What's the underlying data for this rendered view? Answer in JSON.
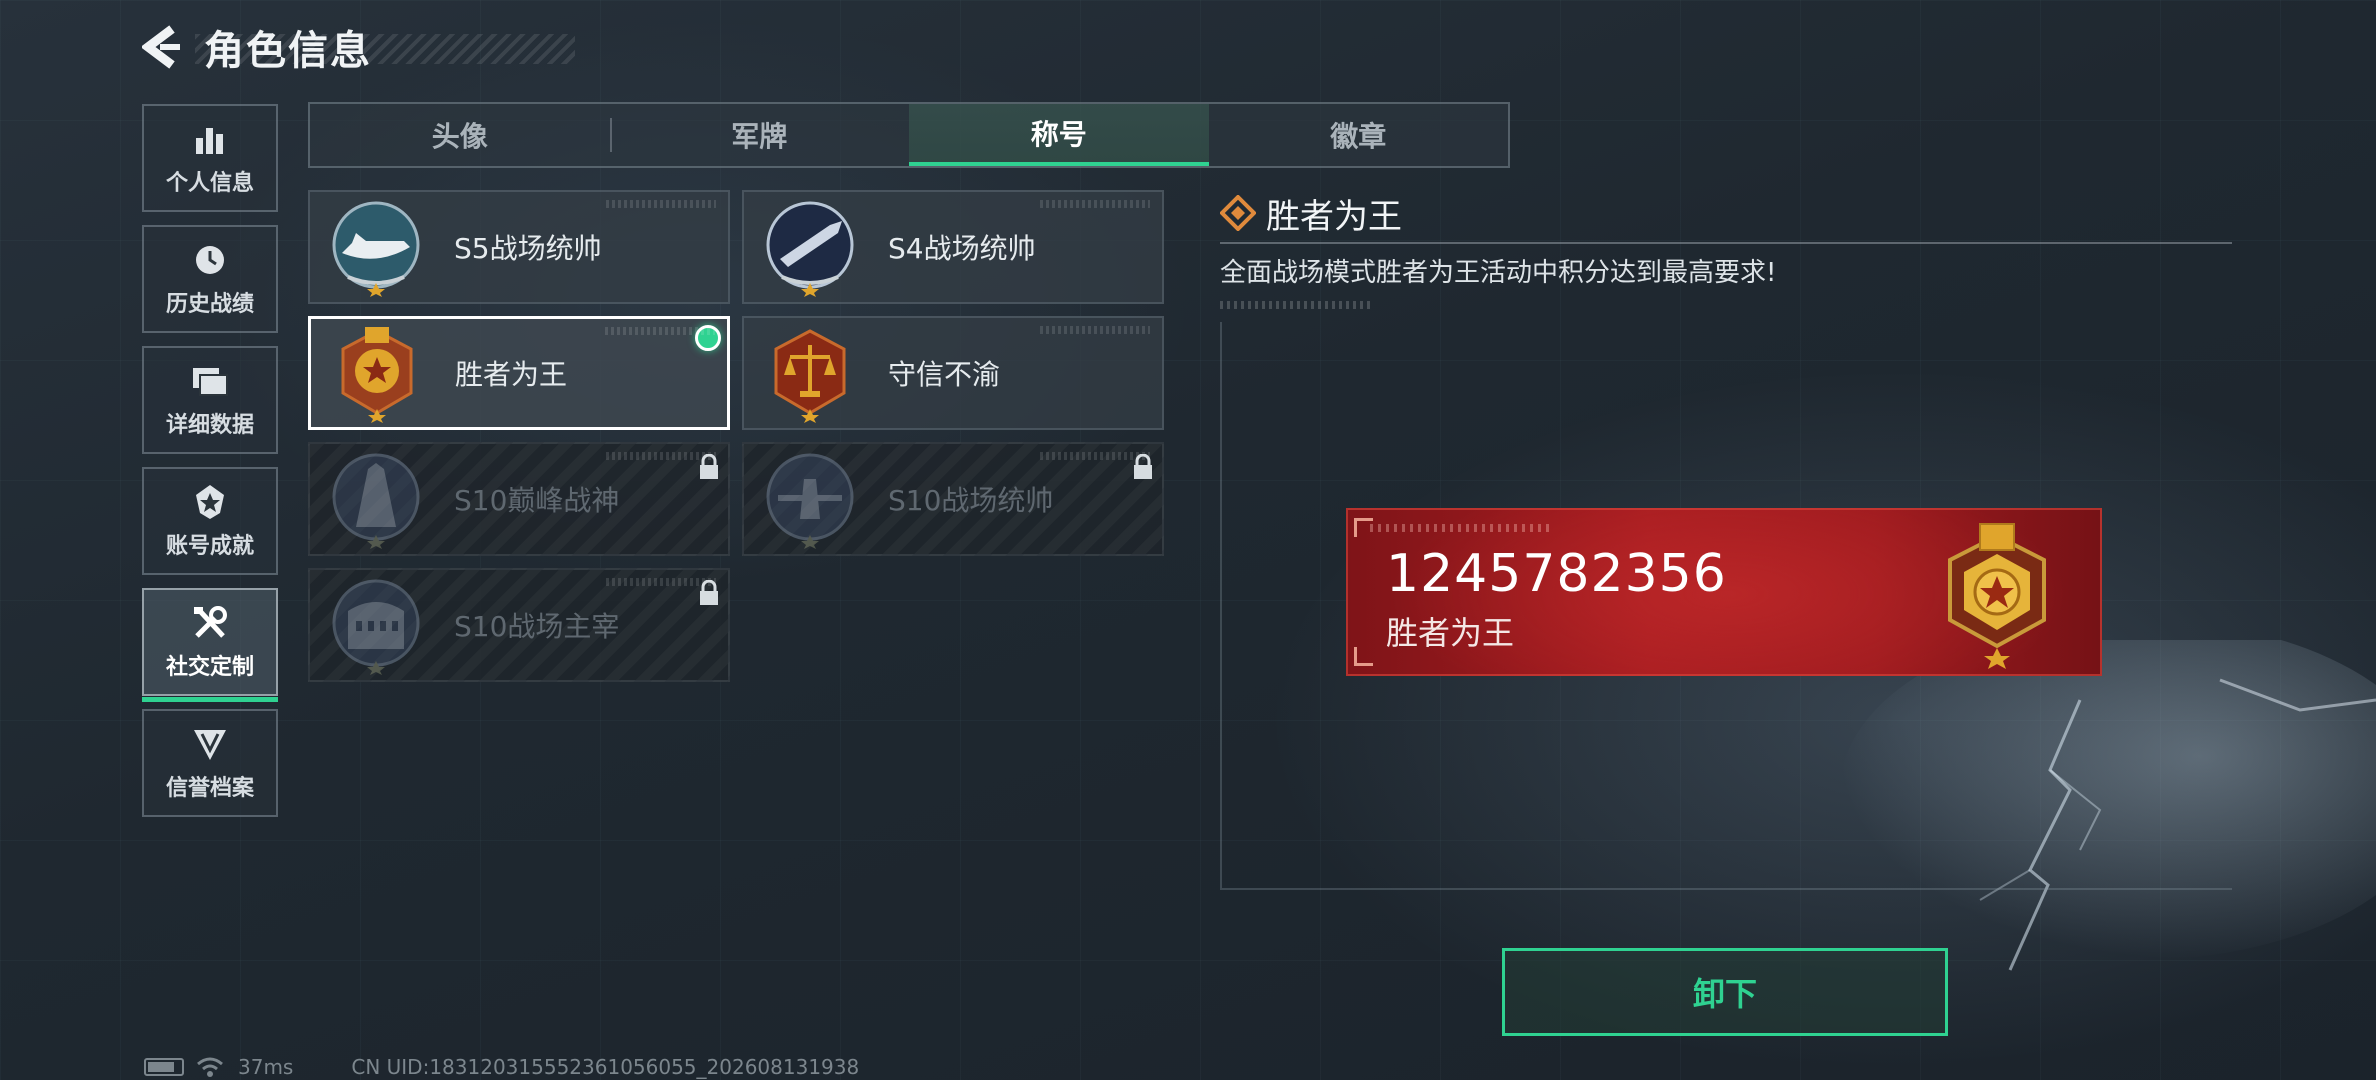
{
  "header": {
    "title": "角色信息"
  },
  "sidebar": {
    "items": [
      {
        "label": "个人信息",
        "icon": "bar-chart-icon",
        "active": false
      },
      {
        "label": "历史战绩",
        "icon": "history-clock-icon",
        "active": false
      },
      {
        "label": "详细数据",
        "icon": "folder-data-icon",
        "active": false
      },
      {
        "label": "账号成就",
        "icon": "achievement-icon",
        "active": false
      },
      {
        "label": "社交定制",
        "icon": "tools-icon",
        "active": true
      },
      {
        "label": "信誉档案",
        "icon": "credit-shield-icon",
        "active": false
      }
    ]
  },
  "tabs": [
    {
      "label": "头像",
      "active": false
    },
    {
      "label": "军牌",
      "active": false
    },
    {
      "label": "称号",
      "active": true
    },
    {
      "label": "徽章",
      "active": false
    }
  ],
  "titles": [
    {
      "name": "S5战场统帅",
      "emblem": "speedboat-emblem-icon",
      "locked": false,
      "selected": false,
      "equipped": false
    },
    {
      "name": "S4战场统帅",
      "emblem": "missile-emblem-icon",
      "locked": false,
      "selected": false,
      "equipped": false
    },
    {
      "name": "胜者为王",
      "emblem": "gold-medal-emblem-icon",
      "locked": false,
      "selected": true,
      "equipped": true
    },
    {
      "name": "守信不渝",
      "emblem": "scales-emblem-icon",
      "locked": false,
      "selected": false,
      "equipped": false
    },
    {
      "name": "S10巅峰战神",
      "emblem": "tower-emblem-icon",
      "locked": true,
      "selected": false,
      "equipped": false
    },
    {
      "name": "S10战场统帅",
      "emblem": "aircraft-emblem-icon",
      "locked": true,
      "selected": false,
      "equipped": false
    },
    {
      "name": "S10战场主宰",
      "emblem": "colosseum-emblem-icon",
      "locked": true,
      "selected": false,
      "equipped": false
    }
  ],
  "detail": {
    "title": "胜者为王",
    "description": "全面战场模式胜者为王活动中积分达到最高要求!"
  },
  "nameplate": {
    "uid": "1245782356",
    "title": "胜者为王"
  },
  "actions": {
    "unequip_label": "卸下"
  },
  "status_bar": {
    "ping": "37ms",
    "uid_text": "CN UID:18312031555236105605​5_202608131938"
  },
  "colors": {
    "accent": "#2fd291",
    "nameplate_red": "#a61c20",
    "gold": "#e0a52c"
  }
}
